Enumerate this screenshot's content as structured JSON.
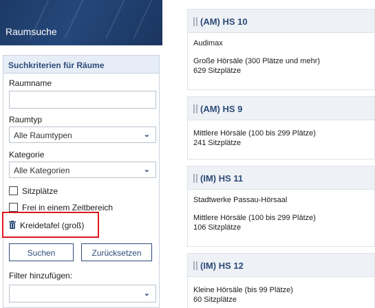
{
  "sidebar": {
    "banner_title": "Raumsuche",
    "panel_title": "Suchkriterien für Räume",
    "raumname_label": "Raumname",
    "raumname_value": "",
    "raumtyp_label": "Raumtyp",
    "raumtyp_value": "Alle Raumtypen",
    "kategorie_label": "Kategorie",
    "kategorie_value": "Alle Kategorien",
    "checkbox_sitzplaetze": "Sitzplätze",
    "checkbox_zeitbereich": "Frei in einem Zeitbereich",
    "filter_kreidetafel": "Kreidetafel (groß)",
    "search_button": "Suchen",
    "reset_button": "Zurücksetzen",
    "add_filter_label": "Filter hinzufügen:",
    "add_filter_value": ""
  },
  "results": [
    {
      "title": "(AM) HS 10",
      "lines": [
        "Audimax",
        "",
        "Große Hörsäle (300 Plätze und mehr)",
        "629 Sitzplätze"
      ]
    },
    {
      "title": "(AM) HS 9",
      "lines": [
        "Mittlere Hörsäle (100 bis 299 Plätze)",
        "241 Sitzplätze"
      ]
    },
    {
      "title": "(IM) HS 11",
      "lines": [
        "Stadtwerke Passau-Hörsaal",
        "",
        "Mittlere Hörsäle (100 bis 299 Plätze)",
        "106 Sitzplätze"
      ]
    },
    {
      "title": "(IM) HS 12",
      "lines": [
        "Kleine Hörsäle (bis 99 Plätze)",
        "60 Sitzplätze"
      ]
    }
  ],
  "colors": {
    "accent": "#2c4a78",
    "highlight": "#e2141b",
    "banner": "#1d3a66"
  }
}
